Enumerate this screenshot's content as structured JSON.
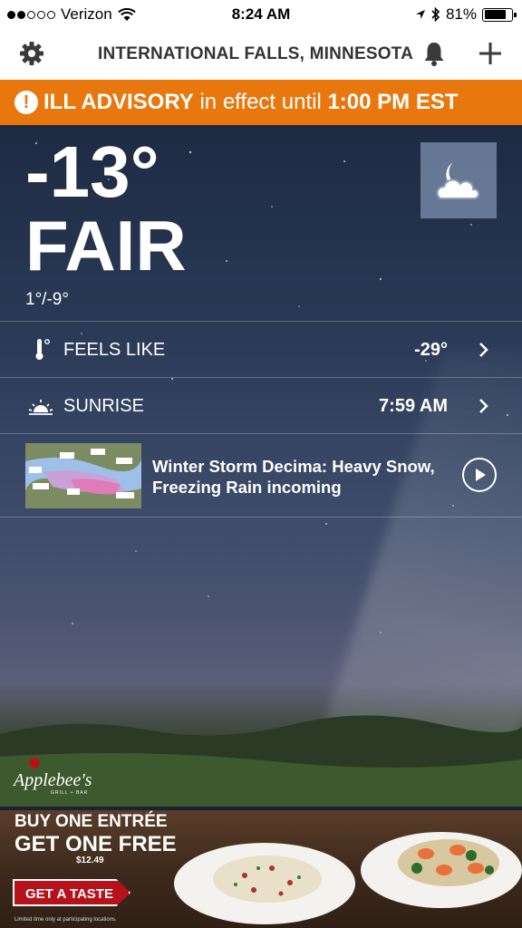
{
  "status_bar": {
    "carrier": "Verizon",
    "time": "8:24 AM",
    "battery": "81%",
    "battery_level": 0.81
  },
  "header": {
    "location": "INTERNATIONAL FALLS, MINNESOTA"
  },
  "alert": {
    "title": "ILL ADVISORY",
    "middle": "in effect until",
    "until": "1:00 PM EST"
  },
  "current": {
    "temperature": "-13°",
    "condition": "FAIR",
    "hi_lo": "1°/-9°"
  },
  "details": [
    {
      "label": "FEELS LIKE",
      "value": "-29°",
      "icon": "thermometer-icon"
    },
    {
      "label": "SUNRISE",
      "value": "7:59 AM",
      "icon": "sunrise-icon"
    }
  ],
  "news": {
    "headline": "Winter Storm Decima: Heavy Snow, Freezing Rain incoming"
  },
  "ad": {
    "brand": "Applebee's",
    "brand_sub": "GRILL + BAR",
    "offer_line1": "BUY ONE ENTRÉE",
    "offer_line2": "GET ONE FREE",
    "price": "$12.49",
    "cta": "GET A TASTE",
    "fine_print": "Limited time only at participating locations."
  },
  "colors": {
    "alert_bg": "#e8770e",
    "ad_red": "#b5121b"
  }
}
